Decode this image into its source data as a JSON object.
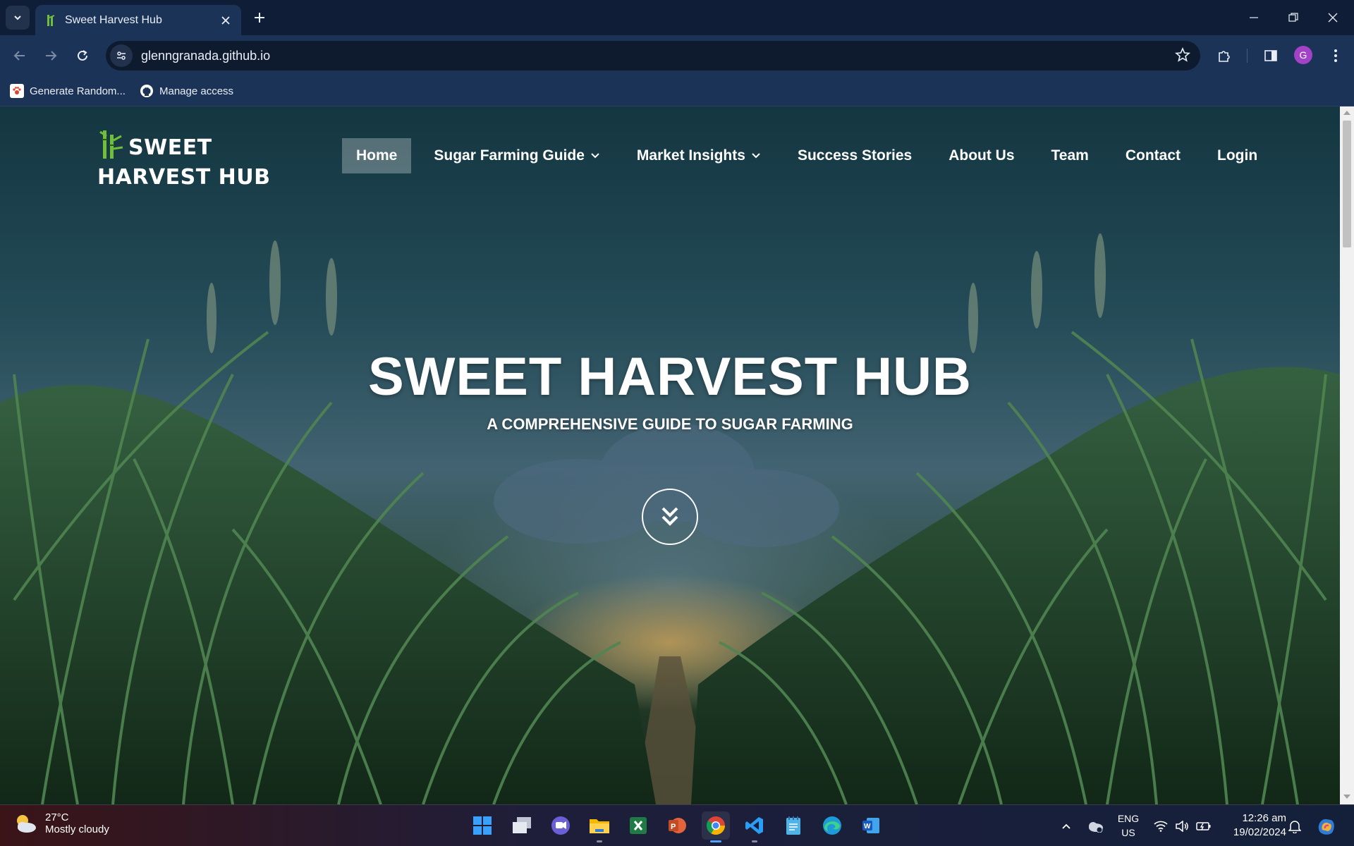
{
  "browser": {
    "tab": {
      "title": "Sweet Harvest Hub"
    },
    "url": "glenngranada.github.io",
    "avatar_letter": "G",
    "bookmarks": [
      {
        "label": "Generate Random...",
        "icon": "paw-icon"
      },
      {
        "label": "Manage access",
        "icon": "github-icon"
      }
    ]
  },
  "site": {
    "logo_text": "SWEET HARVEST HUB",
    "nav": [
      {
        "label": "Home",
        "active": true,
        "dropdown": false
      },
      {
        "label": "Sugar Farming Guide",
        "active": false,
        "dropdown": true
      },
      {
        "label": "Market Insights",
        "active": false,
        "dropdown": true
      },
      {
        "label": "Success Stories",
        "active": false,
        "dropdown": false
      },
      {
        "label": "About Us",
        "active": false,
        "dropdown": false
      },
      {
        "label": "Team",
        "active": false,
        "dropdown": false
      },
      {
        "label": "Contact",
        "active": false,
        "dropdown": false
      },
      {
        "label": "Login",
        "active": false,
        "dropdown": false
      }
    ],
    "hero": {
      "title": "SWEET HARVEST HUB",
      "subtitle": "A COMPREHENSIVE GUIDE TO SUGAR FARMING"
    }
  },
  "taskbar": {
    "weather": {
      "temp": "27°C",
      "desc": "Mostly cloudy"
    },
    "apps": [
      "windows-start",
      "task-view",
      "teams",
      "file-explorer",
      "excel",
      "powerpoint",
      "chrome",
      "vscode",
      "notepad",
      "edge",
      "word"
    ],
    "language": {
      "line1": "ENG",
      "line2": "US"
    },
    "time": "12:26 am",
    "date": "19/02/2024"
  },
  "colors": {
    "brand_green": "#6fbf3a",
    "nav_active_bg": "rgba(255,255,255,0.28)",
    "chrome_bg": "#1c3358"
  }
}
